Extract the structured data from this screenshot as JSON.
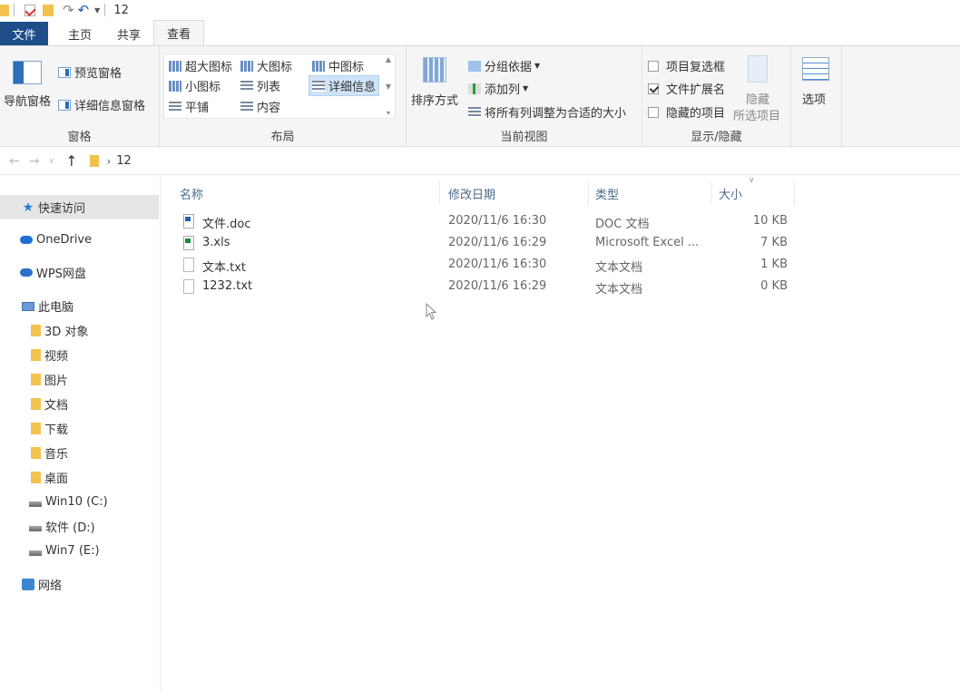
{
  "window": {
    "title": "12"
  },
  "tabs": [
    {
      "label": "文件"
    },
    {
      "label": "主页"
    },
    {
      "label": "共享"
    },
    {
      "label": "查看"
    }
  ],
  "ribbon": {
    "panes": {
      "label": "窗格",
      "nav_pane": "导航窗格",
      "preview_pane": "预览窗格",
      "details_pane": "详细信息窗格"
    },
    "layout": {
      "label": "布局",
      "extra_large": "超大图标",
      "large": "大图标",
      "medium": "中图标",
      "small": "小图标",
      "list": "列表",
      "details": "详细信息",
      "tiles": "平铺",
      "content": "内容"
    },
    "current_view": {
      "label": "当前视图",
      "sort_by": "排序方式",
      "group_by": "分组依据",
      "add_column": "添加列",
      "size_all_columns": "将所有列调整为合适的大小"
    },
    "show_hide": {
      "label": "显示/隐藏",
      "item_checkboxes": "项目复选框",
      "item_checkboxes_checked": false,
      "file_extensions": "文件扩展名",
      "file_extensions_checked": true,
      "hidden_items": "隐藏的项目",
      "hidden_items_checked": false,
      "hide_selected_line1": "隐藏",
      "hide_selected_line2": "所选项目"
    },
    "options": {
      "label": "选项"
    }
  },
  "address": {
    "path": "12"
  },
  "sidebar": {
    "quick_access": "快速访问",
    "onedrive": "OneDrive",
    "wps": "WPS网盘",
    "this_pc": "此电脑",
    "items": [
      {
        "label": "3D 对象"
      },
      {
        "label": "视频"
      },
      {
        "label": "图片"
      },
      {
        "label": "文档"
      },
      {
        "label": "下载"
      },
      {
        "label": "音乐"
      },
      {
        "label": "桌面"
      },
      {
        "label": "Win10 (C:)"
      },
      {
        "label": "软件 (D:)"
      },
      {
        "label": "Win7 (E:)"
      }
    ],
    "network": "网络"
  },
  "filelist": {
    "columns": {
      "name": "名称",
      "date": "修改日期",
      "type": "类型",
      "size": "大小"
    },
    "rows": [
      {
        "name": "文件.doc",
        "date": "2020/11/6 16:30",
        "type": "DOC 文档",
        "size": "10 KB",
        "icon": "doc-file-icon"
      },
      {
        "name": "3.xls",
        "date": "2020/11/6 16:29",
        "type": "Microsoft Excel ...",
        "size": "7 KB",
        "icon": "xls-file-icon"
      },
      {
        "name": "文本.txt",
        "date": "2020/11/6 16:30",
        "type": "文本文档",
        "size": "1 KB",
        "icon": "txt-file-icon"
      },
      {
        "name": "1232.txt",
        "date": "2020/11/6 16:29",
        "type": "文本文档",
        "size": "0 KB",
        "icon": "txt-file-icon"
      }
    ]
  },
  "colors": {
    "file_tab": "#1e4e89",
    "ribbon_bg": "#f5f5f5",
    "selected": "#cfe3f7",
    "quick_access_bg": "#e5e5e5"
  }
}
